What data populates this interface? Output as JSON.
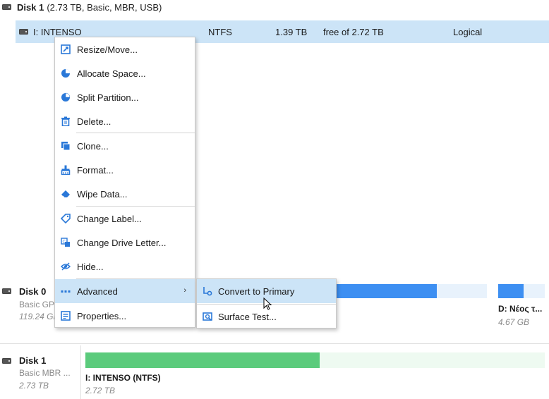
{
  "disk_header": {
    "name": "Disk 1",
    "info": "(2.73 TB, Basic, MBR, USB)",
    "icon": "hdd-icon"
  },
  "partition_row": {
    "name": "I: INTENSO",
    "filesystem": "NTFS",
    "used": "1.39 TB",
    "free": "free of 2.72 TB",
    "type": "Logical"
  },
  "context_menu": {
    "items": [
      {
        "label": "Resize/Move...",
        "icon": "resize-icon"
      },
      {
        "label": "Allocate Space...",
        "icon": "pie-chart-icon"
      },
      {
        "label": "Split Partition...",
        "icon": "split-pie-icon"
      },
      {
        "label": "Delete...",
        "icon": "trash-icon"
      },
      {
        "label": "Clone...",
        "icon": "clone-icon"
      },
      {
        "label": "Format...",
        "icon": "format-brush-icon"
      },
      {
        "label": "Wipe Data...",
        "icon": "eraser-icon"
      },
      {
        "label": "Change Label...",
        "icon": "tag-icon"
      },
      {
        "label": "Change Drive Letter...",
        "icon": "drive-letter-icon"
      },
      {
        "label": "Hide...",
        "icon": "eye-hidden-icon"
      },
      {
        "label": "Advanced",
        "icon": "more-dots-icon",
        "has_submenu": true
      },
      {
        "label": "Properties...",
        "icon": "properties-icon"
      }
    ]
  },
  "submenu": {
    "items": [
      {
        "label": "Convert to Primary",
        "icon": "convert-icon"
      },
      {
        "label": "Surface Test...",
        "icon": "surface-test-icon"
      }
    ]
  },
  "disk0": {
    "title": "Disk 0",
    "subtitle": "Basic GPT",
    "size": "119.24 GB",
    "partition_d_label": "D: Νέος τ...",
    "partition_d_size": "4.67 GB"
  },
  "disk1_panel": {
    "title": "Disk 1",
    "subtitle": "Basic MBR ...",
    "size": "2.73 TB",
    "partition_label": "I: INTENSO (NTFS)",
    "partition_size": "2.72 TB",
    "used_fraction": 0.51
  },
  "colors": {
    "accent": "#3d8ff2",
    "selection": "#cce4f7",
    "used_green": "#5bcb7c"
  }
}
